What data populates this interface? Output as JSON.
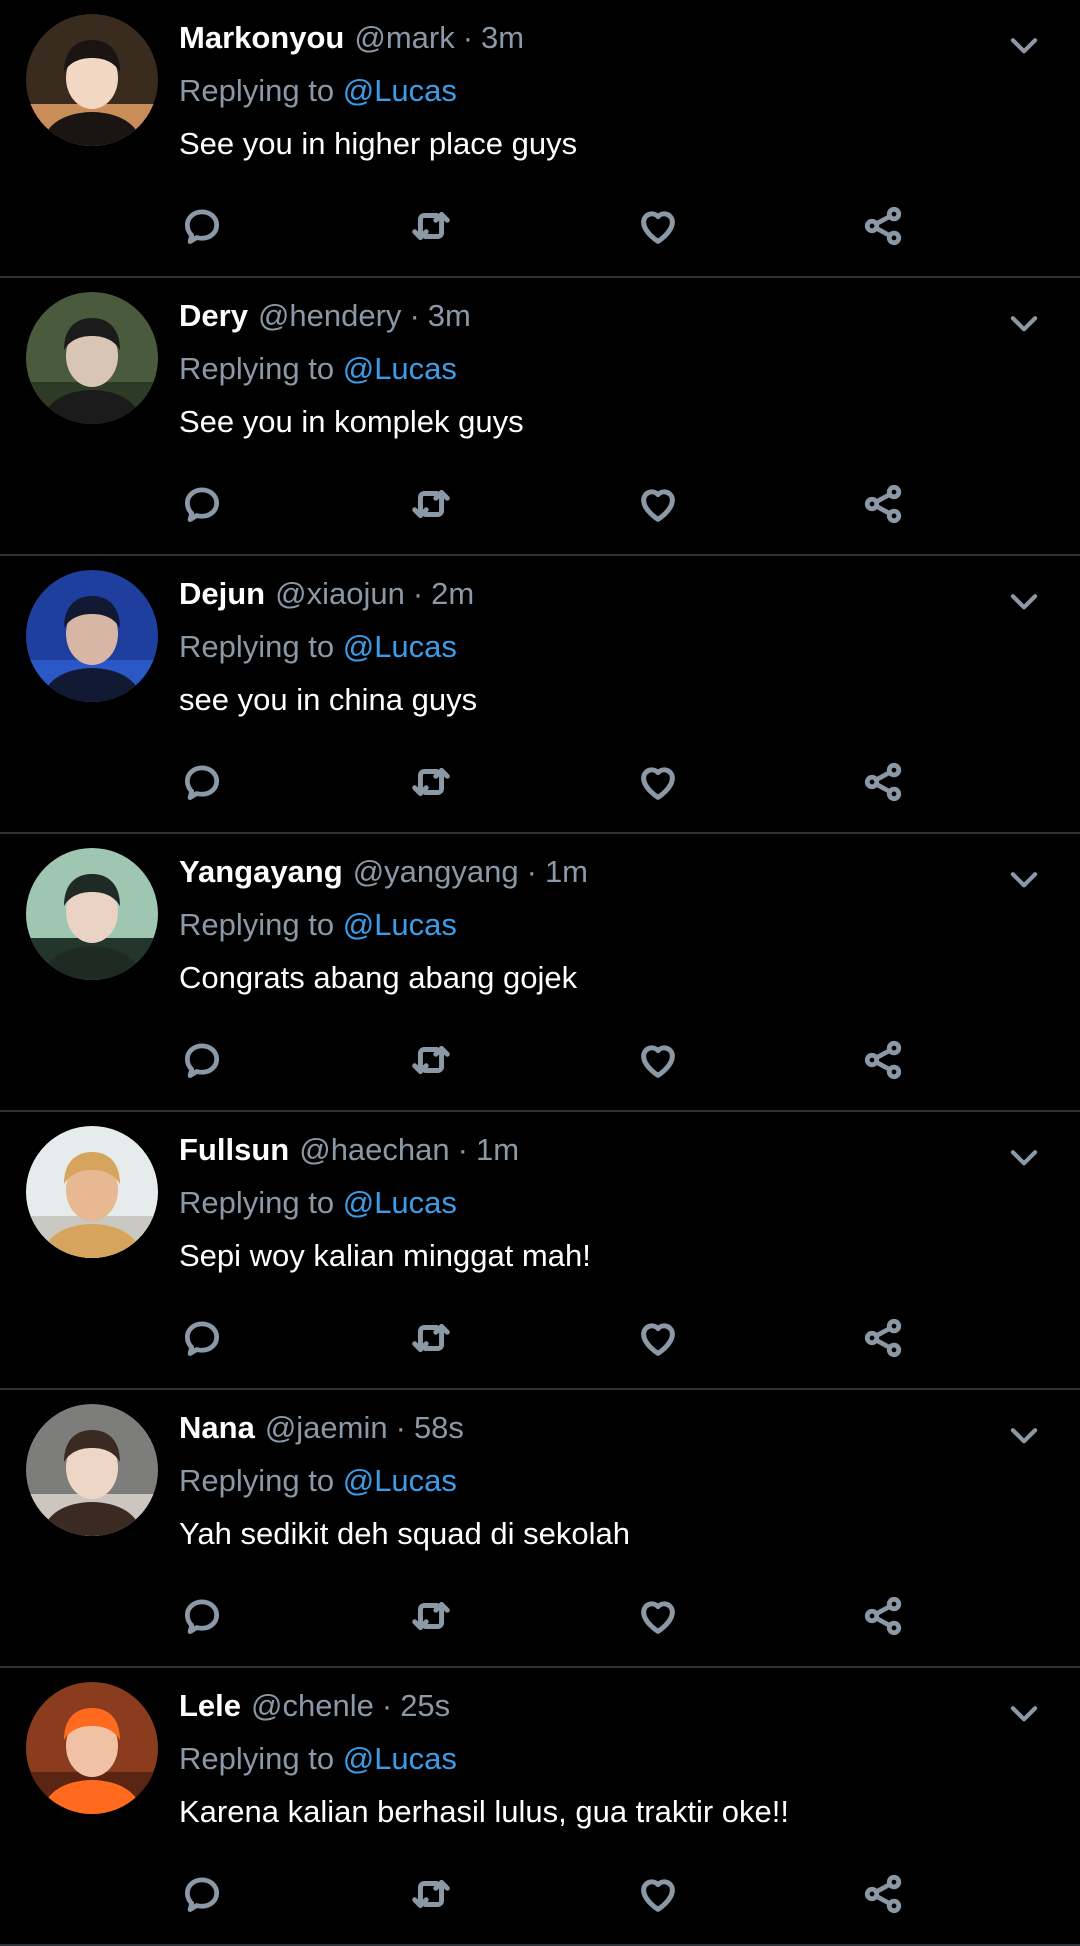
{
  "colors": {
    "background": "#000000",
    "text_primary": "#ffffff",
    "text_secondary": "#8b98a5",
    "link": "#3b9dea",
    "divider": "#2f3336"
  },
  "icons": {
    "reply": "speech-bubble-icon",
    "retweet": "retweet-arrows-icon",
    "like": "heart-outline-icon",
    "share": "share-nodes-icon",
    "menu": "chevron-down-icon"
  },
  "replying_prefix": "Replying to",
  "tweets": [
    {
      "display_name": "Markonyou",
      "handle": "@mark",
      "dot": "·",
      "time": "3m",
      "reply_to": "@Lucas",
      "text": "See you in higher place guys",
      "avatar_palette": [
        "#3a2b1f",
        "#f2d7c2",
        "#1a1412",
        "#c98d5a"
      ]
    },
    {
      "display_name": "Dery",
      "handle": "@hendery",
      "dot": "·",
      "time": "3m",
      "reply_to": "@Lucas",
      "text": "See you in komplek guys",
      "avatar_palette": [
        "#4a5a3c",
        "#d9c5b4",
        "#1b1b1b",
        "#2d3a25"
      ]
    },
    {
      "display_name": "Dejun",
      "handle": "@xiaojun",
      "dot": "·",
      "time": "2m",
      "reply_to": "@Lucas",
      "text": "see you in china guys",
      "avatar_palette": [
        "#1f3f9e",
        "#d8b6a5",
        "#121a33",
        "#2b58c7"
      ]
    },
    {
      "display_name": "Yangayang",
      "handle": "@yangyang",
      "dot": "·",
      "time": "1m",
      "reply_to": "@Lucas",
      "text": "Congrats abang abang gojek",
      "avatar_palette": [
        "#9fc6b0",
        "#ead3c4",
        "#1f2a24",
        "#22362c"
      ]
    },
    {
      "display_name": "Fullsun",
      "handle": "@haechan",
      "dot": "·",
      "time": "1m",
      "reply_to": "@Lucas",
      "text": "Sepi woy kalian minggat mah!",
      "avatar_palette": [
        "#e6ecec",
        "#e7b892",
        "#d6a45c",
        "#c9c9c1"
      ]
    },
    {
      "display_name": "Nana",
      "handle": "@jaemin",
      "dot": "·",
      "time": "58s",
      "reply_to": "@Lucas",
      "text": "Yah sedikit deh squad di sekolah",
      "avatar_palette": [
        "#7d7d7b",
        "#eed6c6",
        "#3a2a22",
        "#cbc6c0"
      ]
    },
    {
      "display_name": "Lele",
      "handle": "@chenle",
      "dot": "·",
      "time": "25s",
      "reply_to": "@Lucas",
      "text": "Karena kalian berhasil lulus, gua traktir oke!!",
      "avatar_palette": [
        "#8b3b1e",
        "#f1c1a6",
        "#ff6a1f",
        "#5a2512"
      ]
    }
  ]
}
